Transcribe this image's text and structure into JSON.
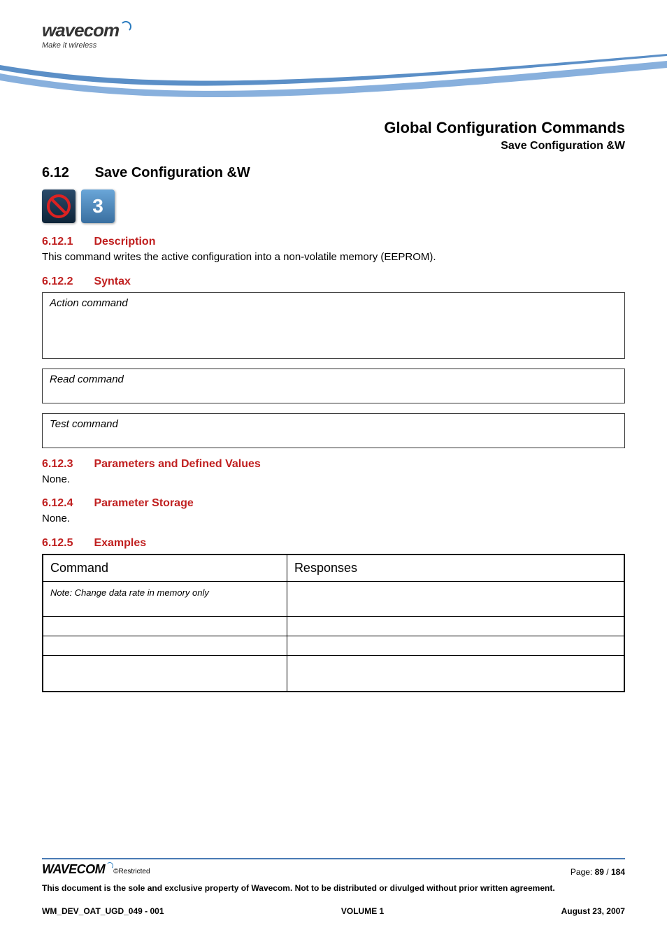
{
  "brand": {
    "name": "wavecom",
    "tagline": "Make it wireless"
  },
  "header": {
    "title": "Global Configuration Commands",
    "subtitle": "Save Configuration &W"
  },
  "section": {
    "number": "6.12",
    "title": "Save Configuration &W"
  },
  "sub": {
    "s1": {
      "num": "6.12.1",
      "title": "Description",
      "text": "This command writes the active configuration into a non-volatile memory (EEPROM)."
    },
    "s2": {
      "num": "6.12.2",
      "title": "Syntax",
      "action": "Action command",
      "read": "Read command",
      "test": "Test command"
    },
    "s3": {
      "num": "6.12.3",
      "title": "Parameters and Defined Values",
      "text": "None."
    },
    "s4": {
      "num": "6.12.4",
      "title": "Parameter Storage",
      "text": "None."
    },
    "s5": {
      "num": "6.12.5",
      "title": "Examples"
    }
  },
  "examples": {
    "head_cmd": "Command",
    "head_resp": "Responses",
    "note": "Note: Change data rate in memory only"
  },
  "footer": {
    "logo": "WAVECOM",
    "restricted": "©Restricted",
    "page_label": "Page: ",
    "page_cur": "89",
    "page_sep": " / ",
    "page_total": "184",
    "disclaimer": "This document is the sole and exclusive property of Wavecom. Not to be distributed or divulged without prior written agreement.",
    "doc_id": "WM_DEV_OAT_UGD_049 - 001",
    "volume": "VOLUME 1",
    "date": "August 23, 2007"
  }
}
